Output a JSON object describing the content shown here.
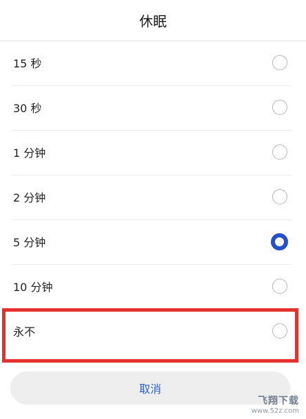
{
  "dialog": {
    "title": "休眠",
    "options": [
      {
        "label": "15 秒",
        "selected": false
      },
      {
        "label": "30 秒",
        "selected": false
      },
      {
        "label": "1 分钟",
        "selected": false
      },
      {
        "label": "2 分钟",
        "selected": false
      },
      {
        "label": "5 分钟",
        "selected": true
      },
      {
        "label": "10 分钟",
        "selected": false
      },
      {
        "label": "永不",
        "selected": false
      }
    ],
    "cancel_label": "取消"
  },
  "highlight": {
    "color": "#e53030",
    "target": "永不"
  },
  "watermark": {
    "title": "飞翔下载",
    "url": "www.52z.com"
  },
  "colors": {
    "accent": "#2451c8",
    "cancel_text": "#2f5fd0"
  }
}
